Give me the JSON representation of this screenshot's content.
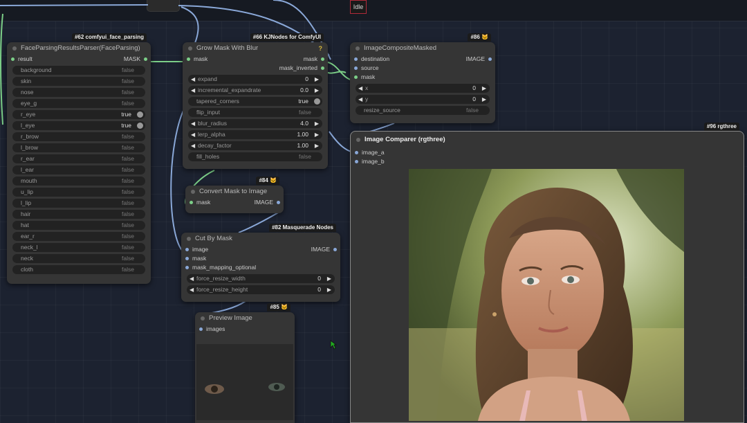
{
  "status": "Idle",
  "nodes": {
    "face_parsing": {
      "title": "FaceParsingResultsParser(FaceParsing)",
      "badge": "#62 comfyui_face_parsing",
      "input": "result",
      "output": "MASK",
      "widgets": [
        {
          "label": "background",
          "value": "false"
        },
        {
          "label": "skin",
          "value": "false"
        },
        {
          "label": "nose",
          "value": "false"
        },
        {
          "label": "eye_g",
          "value": "false"
        },
        {
          "label": "r_eye",
          "value": "true"
        },
        {
          "label": "l_eye",
          "value": "true"
        },
        {
          "label": "r_brow",
          "value": "false"
        },
        {
          "label": "l_brow",
          "value": "false"
        },
        {
          "label": "r_ear",
          "value": "false"
        },
        {
          "label": "l_ear",
          "value": "false"
        },
        {
          "label": "mouth",
          "value": "false"
        },
        {
          "label": "u_lip",
          "value": "false"
        },
        {
          "label": "l_lip",
          "value": "false"
        },
        {
          "label": "hair",
          "value": "false"
        },
        {
          "label": "hat",
          "value": "false"
        },
        {
          "label": "ear_r",
          "value": "false"
        },
        {
          "label": "neck_l",
          "value": "false"
        },
        {
          "label": "neck",
          "value": "false"
        },
        {
          "label": "cloth",
          "value": "false"
        }
      ]
    },
    "grow_mask": {
      "title": "Grow Mask With Blur",
      "badge": "#66 KJNodes for ComfyUI",
      "help": "?",
      "input": "mask",
      "outputs": [
        "mask",
        "mask_inverted"
      ],
      "widgets": [
        {
          "label": "expand",
          "value": "0"
        },
        {
          "label": "incremental_expandrate",
          "value": "0.0"
        },
        {
          "label": "tapered_corners",
          "value": "true"
        },
        {
          "label": "flip_input",
          "value": "false"
        },
        {
          "label": "blur_radius",
          "value": "4.0"
        },
        {
          "label": "lerp_alpha",
          "value": "1.00"
        },
        {
          "label": "decay_factor",
          "value": "1.00"
        },
        {
          "label": "fill_holes",
          "value": "false"
        }
      ]
    },
    "composite": {
      "title": "ImageCompositeMasked",
      "badge": "#86 🐱",
      "inputs": [
        "destination",
        "source",
        "mask"
      ],
      "output": "IMAGE",
      "widgets": [
        {
          "label": "x",
          "value": "0"
        },
        {
          "label": "y",
          "value": "0"
        },
        {
          "label": "resize_source",
          "value": "false"
        }
      ]
    },
    "convert_mask": {
      "title": "Convert Mask to Image",
      "badge": "#84 🐱",
      "input": "mask",
      "output": "IMAGE"
    },
    "cut_by_mask": {
      "title": "Cut By Mask",
      "badge": "#82 Masquerade Nodes",
      "inputs": [
        "image",
        "mask",
        "mask_mapping_optional"
      ],
      "output": "IMAGE",
      "widgets": [
        {
          "label": "force_resize_width",
          "value": "0"
        },
        {
          "label": "force_resize_height",
          "value": "0"
        }
      ]
    },
    "preview": {
      "title": "Preview Image",
      "badge": "#85 🐱",
      "input": "images"
    },
    "comparer": {
      "title": "Image Comparer (rgthree)",
      "badge": "#96 rgthree",
      "inputs": [
        "image_a",
        "image_b"
      ]
    }
  },
  "colors": {
    "canvas": "#1c2230",
    "node_bg": "#353535",
    "widget_bg": "#222222",
    "mask_wire": "#7ccf88",
    "image_wire": "#8aa8d8",
    "status_border": "#b02a3a"
  }
}
